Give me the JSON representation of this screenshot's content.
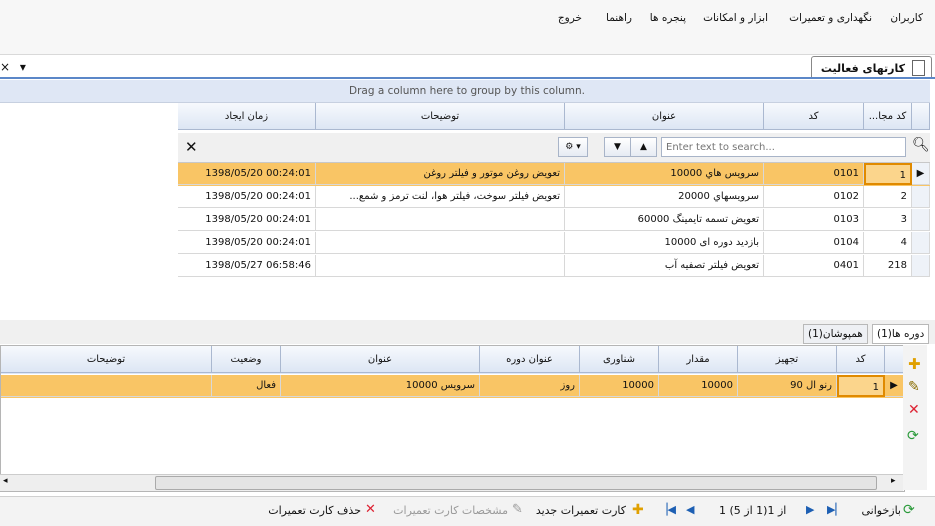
{
  "menu": {
    "items": [
      "کاربران",
      "نگهداری و تعمیرات",
      "ابزار و امکانات",
      "پنجره ها",
      "راهنما",
      "خروج"
    ]
  },
  "tab": {
    "label": "کارتهای فعالیت"
  },
  "window_controls": {
    "close": "×",
    "dropdown": "▾"
  },
  "group_panel": {
    "text": "Drag a column here to group by this column."
  },
  "main_grid": {
    "columns": [
      "کد مجا...",
      "کد",
      "عنوان",
      "توضیحات",
      "زمان ایجاد"
    ],
    "search_placeholder": "Enter text to search...",
    "rows": [
      {
        "no": "1",
        "code": "0101",
        "title": "سرويس هاي 10000",
        "desc": "تعویض روغن موتور و فیلتر روغن",
        "time": "1398/05/20 00:24:01",
        "selected": true
      },
      {
        "no": "2",
        "code": "0102",
        "title": "سرويسهاي 20000",
        "desc": "تعويض فيلتر سوخت، فیلتر هوا، لنت ترمز و شمع...",
        "time": "1398/05/20 00:24:01",
        "selected": false
      },
      {
        "no": "3",
        "code": "0103",
        "title": "تعویض تسمه تایمینگ 60000",
        "desc": "",
        "time": "1398/05/20 00:24:01",
        "selected": false
      },
      {
        "no": "4",
        "code": "0104",
        "title": "بازدید دوره ای 10000",
        "desc": "",
        "time": "1398/05/20 00:24:01",
        "selected": false
      },
      {
        "no": "218",
        "code": "0401",
        "title": "تعویض فیلتر تصفیه آب",
        "desc": "",
        "time": "1398/05/27 06:58:46",
        "selected": false
      }
    ]
  },
  "lower_tabs": [
    "دوره ها(1)",
    "همپوشان(1)"
  ],
  "lower_grid": {
    "columns": [
      "کد",
      "تجهیز",
      "مقدار",
      "شناوری",
      "عنوان دوره",
      "عنوان",
      "وضعیت",
      "توضیحات"
    ],
    "rows": [
      {
        "code": "1",
        "equipment": "رنو ال 90",
        "amount": "10000",
        "float": "10000",
        "period_title": "روز",
        "title": "سرويس 10000",
        "status": "فعال",
        "desc": ""
      }
    ]
  },
  "bottom": {
    "reload": "بازخوانی",
    "pager": "1 از 1(1 از 5)",
    "new_card": "کارت تعمیرات جدید",
    "card_details": "مشخصات کارت تعمیرات",
    "delete_card": "حذف کارت تعمیرات"
  },
  "colors": {
    "selection": "#f9c565",
    "header": "#dde6f4",
    "accent": "#5b87c8"
  }
}
